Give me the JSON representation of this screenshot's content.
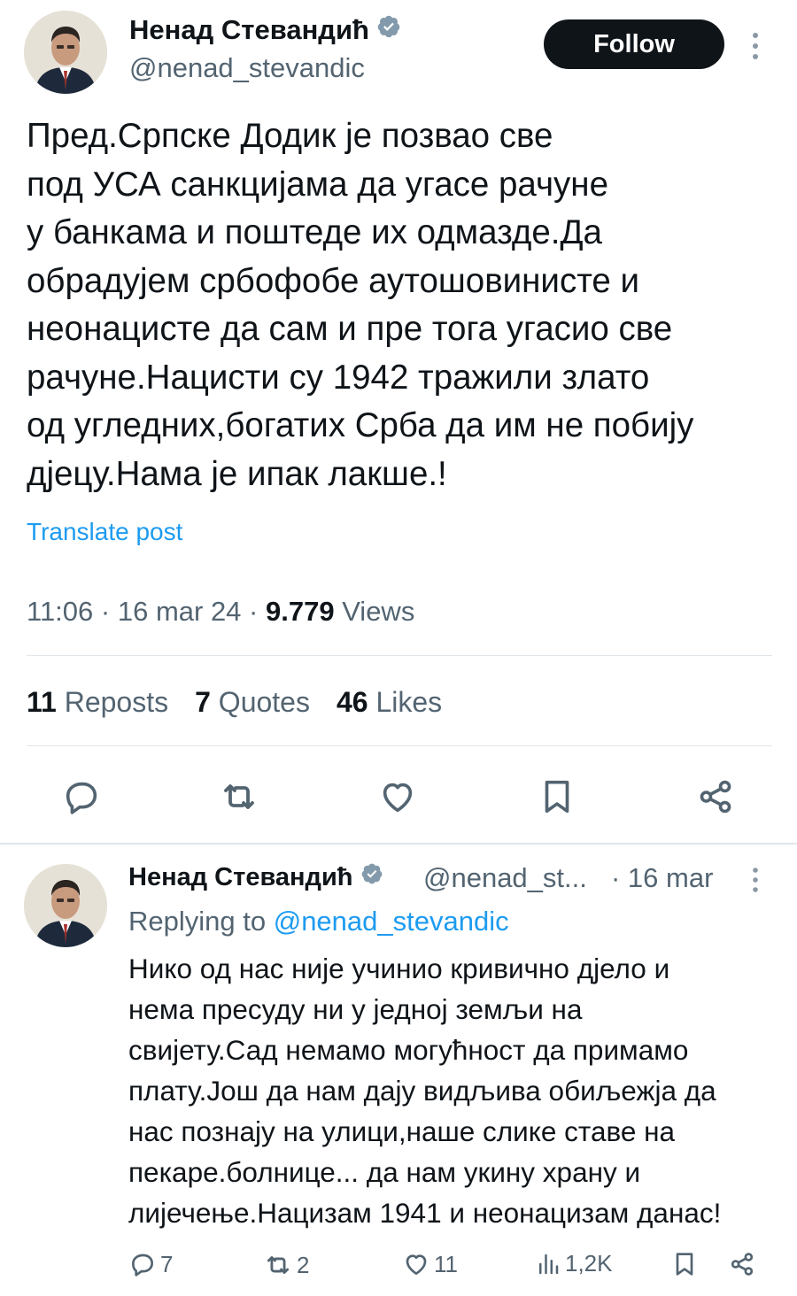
{
  "main_post": {
    "author_name": "Ненад Стевандић",
    "handle": "@nenad_stevandic",
    "follow_label": "Follow",
    "text_lines": [
      "Пред.Српске Додик је позвао све",
      "под УСА санкцијама да угасе рачуне",
      "у банкама и поштеде их одмазде.Да",
      "обрадујем србофобе аутошовинисте и",
      "неонацисте да сам и пре тога угасио све",
      "рачуне.Нацисти су 1942 тражили злато",
      "од угледних,богатих Срба да им не побију",
      "дјецу.Нама је ипак лакше.!"
    ],
    "translate_label": "Translate post",
    "time": "11:06",
    "date": "16 mar 24",
    "views_count": "9.779",
    "views_label": "Views",
    "reposts_count": "11",
    "reposts_label": "Reposts",
    "quotes_count": "7",
    "quotes_label": "Quotes",
    "likes_count": "46",
    "likes_label": "Likes",
    "actions": [
      "reply-icon",
      "repost-icon",
      "like-icon",
      "bookmark-icon",
      "share-icon"
    ]
  },
  "reply_post": {
    "author_name": "Ненад Стевандић",
    "handle": "@nenad_st...",
    "date": "· 16 mar",
    "replying_label": "Replying to",
    "replying_handle": "@nenad_stevandic",
    "text_lines": [
      "Нико од нас није учинио кривично дјело и",
      "нема пресуду ни у једној земљи на",
      "свијету.Сад немамо могућност да примамо",
      "плату.Још да нам дају видљива обиљежја да",
      "нас познају на улици,наше слике ставе на",
      "пекаре.болнице... да нам  укину храну и",
      "лијечење.Нацизам 1941 и неонацизам данас!"
    ],
    "reply_count": "7",
    "repost_count": "2",
    "like_count": "11",
    "views_count": "1,2K"
  },
  "colors": {
    "text": "#0f1419",
    "secondary": "#536471",
    "link": "#1d9bf0",
    "verified": "#829aab",
    "divider": "#e1e6ea"
  }
}
